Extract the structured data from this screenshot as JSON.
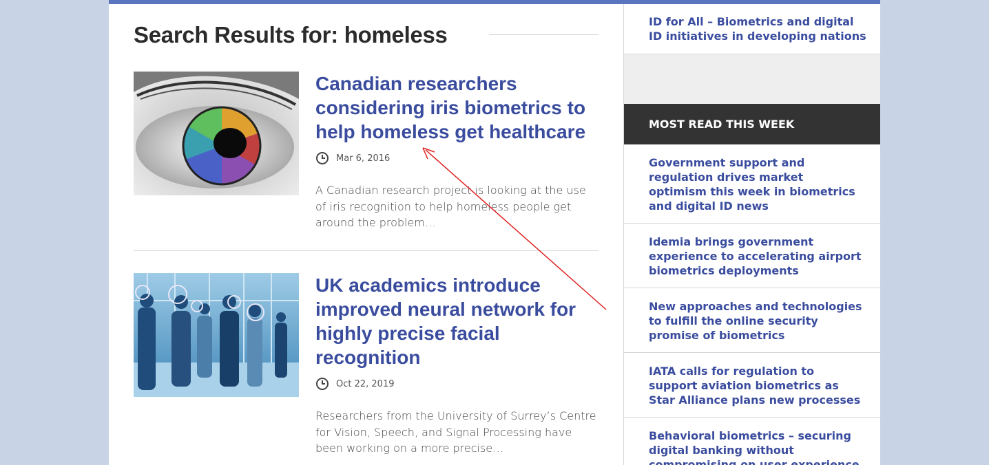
{
  "search": {
    "title": "Search Results for: homeless"
  },
  "articles": [
    {
      "title": "Canadian researchers considering iris biometrics to help homeless get healthcare",
      "date": "Mar 6, 2016",
      "excerpt": "A Canadian research project is looking at the use of iris recognition to help homeless people get around the problem…",
      "image": "colorful-iris-eye-photo"
    },
    {
      "title": "UK academics introduce improved neural network for highly precise facial recognition",
      "date": "Oct 22, 2019",
      "excerpt": "Researchers from the University of Surrey’s Centre for Vision, Speech, and Signal Processing have been working on a more precise…",
      "image": "business-people-face-recognition-photo"
    }
  ],
  "sidebar": {
    "top_link": "ID for All – Biometrics and digital ID initiatives in developing nations",
    "most_read_heading": "MOST READ THIS WEEK",
    "most_read": [
      "Government support and regulation drives market optimism this week in biometrics and digital ID news",
      "Idemia brings government experience to accelerating airport biometrics deployments",
      "New approaches and technologies to fulfill the online security promise of biometrics",
      "IATA calls for regulation to support aviation biometrics as Star Alliance plans new processes",
      "Behavioral biometrics – securing digital banking without compromising on user experience"
    ]
  },
  "colors": {
    "link": "#3a4c9e",
    "top_bar": "#5a74c0",
    "background": "#c8d4e6",
    "most_read_bg": "#333333",
    "annotation_arrow": "#e02020"
  },
  "icons": {
    "date": "clock-icon"
  }
}
